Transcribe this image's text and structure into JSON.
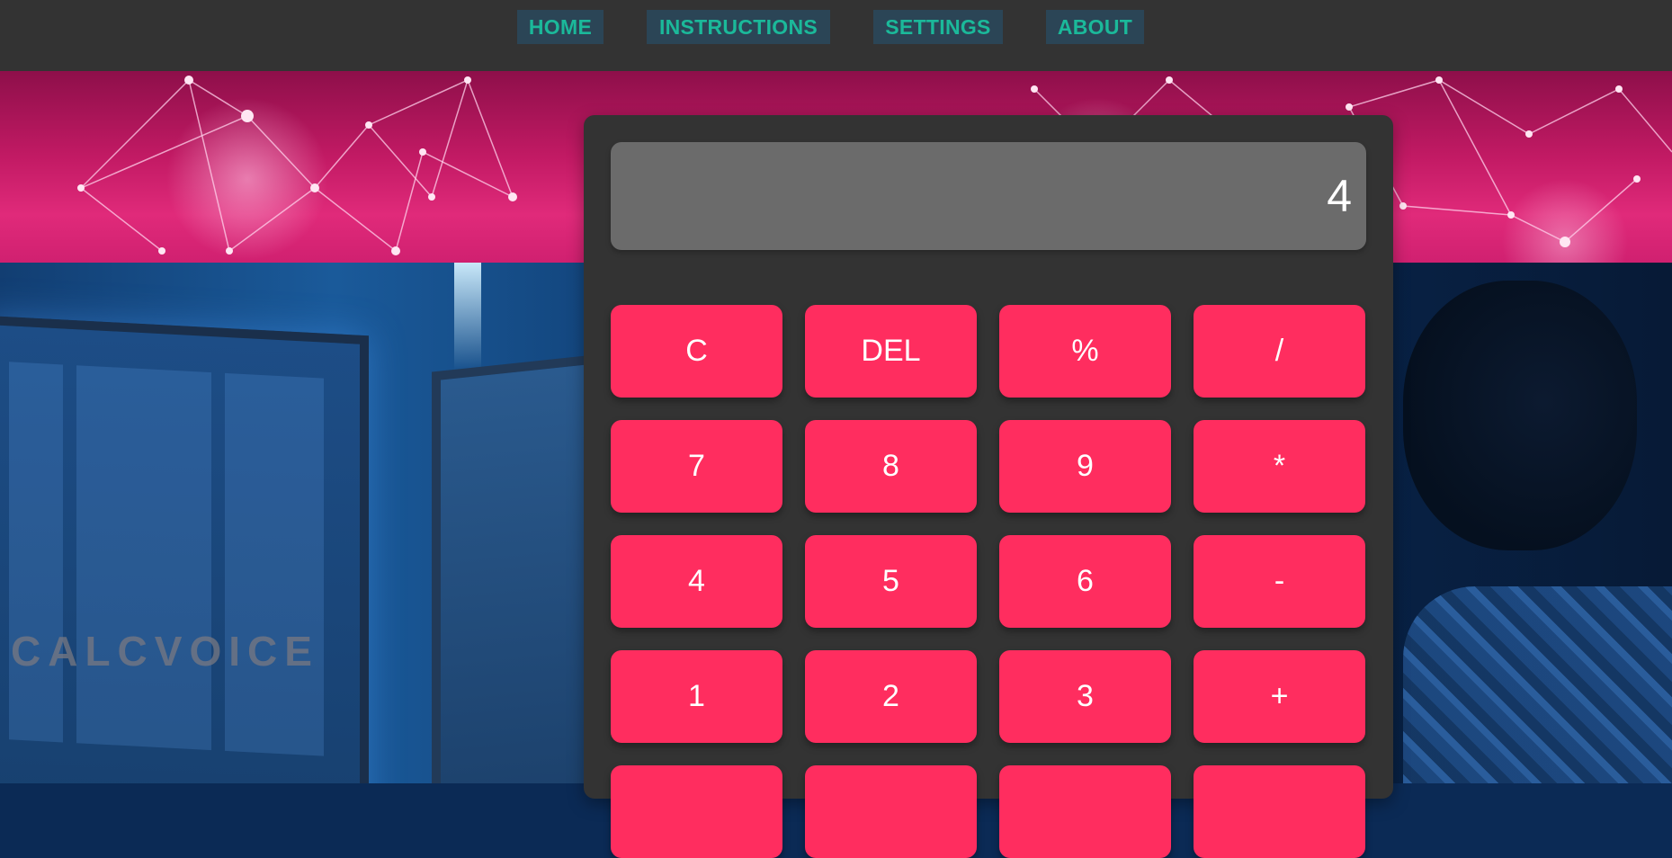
{
  "nav": {
    "items": [
      {
        "label": "HOME"
      },
      {
        "label": "INSTRUCTIONS"
      },
      {
        "label": "SETTINGS"
      },
      {
        "label": "ABOUT"
      }
    ]
  },
  "watermark": "CALCVOICE",
  "calculator": {
    "display": "4",
    "keys": [
      [
        "C",
        "DEL",
        "%",
        "/"
      ],
      [
        "7",
        "8",
        "9",
        "*"
      ],
      [
        "4",
        "5",
        "6",
        "-"
      ],
      [
        "1",
        "2",
        "3",
        "+"
      ],
      [
        "",
        "",
        "",
        ""
      ]
    ]
  },
  "colors": {
    "nav_bg": "#333333",
    "nav_link_bg": "#2b4556",
    "nav_link_text": "#1bb99a",
    "calculator_bg": "#333333",
    "display_bg": "#6b6b6b",
    "key_bg": "#ff2d5f",
    "key_text": "#ffffff"
  }
}
